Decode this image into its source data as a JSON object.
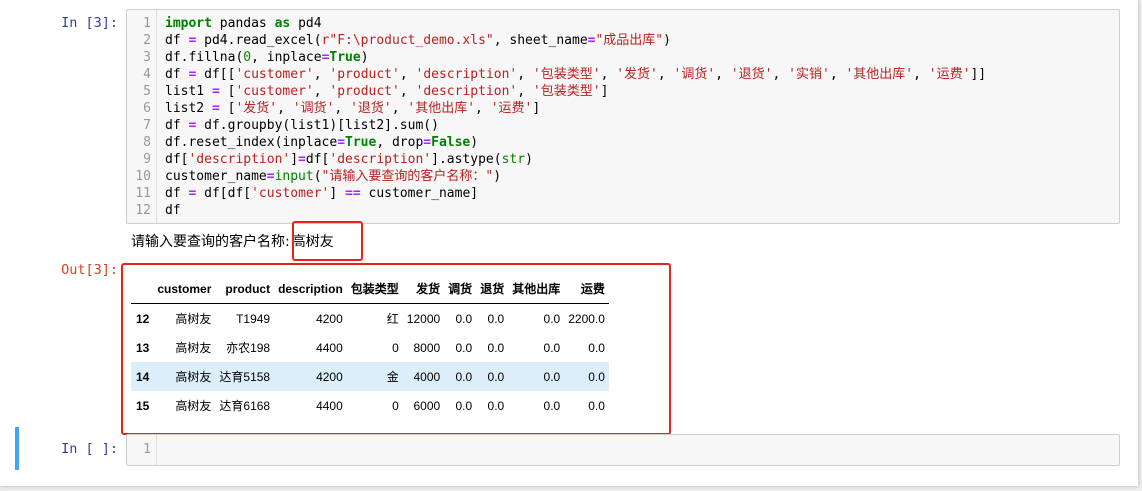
{
  "cell1": {
    "in_prompt": "In [3]:",
    "out_prompt": "Out[3]:",
    "line_numbers": [
      "1",
      "2",
      "3",
      "4",
      "5",
      "6",
      "7",
      "8",
      "9",
      "10",
      "11",
      "12"
    ],
    "code_lines": [
      "import pandas as pd4",
      "df = pd4.read_excel(r\"F:\\product_demo.xls\", sheet_name=\"成品出库\")",
      "df.fillna(0, inplace=True)",
      "df = df[['customer', 'product', 'description', '包装类型', '发货', '调货', '退货', '实销', '其他出库', '运费']]",
      "list1 = ['customer', 'product', 'description', '包装类型']",
      "list2 = ['发货', '调货', '退货', '其他出库', '运费']",
      "df = df.groupby(list1)[list2].sum()",
      "df.reset_index(inplace=True, drop=False)",
      "df['description']=df['description'].astype(str)",
      "customer_name=input(\"请输入要查询的客户名称：\")",
      "df = df[df['customer'] == customer_name]",
      "df"
    ],
    "stdout_prompt": "请输入要查询的客户名称:",
    "stdout_input": "高树友",
    "table": {
      "columns": [
        "",
        "customer",
        "product",
        "description",
        "包装类型",
        "发货",
        "调货",
        "退货",
        "其他出库",
        "运费"
      ],
      "rows": [
        [
          "12",
          "高树友",
          "T1949",
          "4200",
          "红",
          "12000",
          "0.0",
          "0.0",
          "0.0",
          "2200.0"
        ],
        [
          "13",
          "高树友",
          "亦农198",
          "4400",
          "0",
          "8000",
          "0.0",
          "0.0",
          "0.0",
          "0.0"
        ],
        [
          "14",
          "高树友",
          "达育5158",
          "4200",
          "金",
          "4000",
          "0.0",
          "0.0",
          "0.0",
          "0.0"
        ],
        [
          "15",
          "高树友",
          "达育6168",
          "4400",
          "0",
          "6000",
          "0.0",
          "0.0",
          "0.0",
          "0.0"
        ]
      ]
    }
  },
  "cell2": {
    "in_prompt": "In [ ]:",
    "line_numbers": [
      "1"
    ]
  },
  "colors": {
    "highlight_box": "#e8231d",
    "selected_row": "#dceefa",
    "active_cell_bar": "#42a5f5"
  }
}
